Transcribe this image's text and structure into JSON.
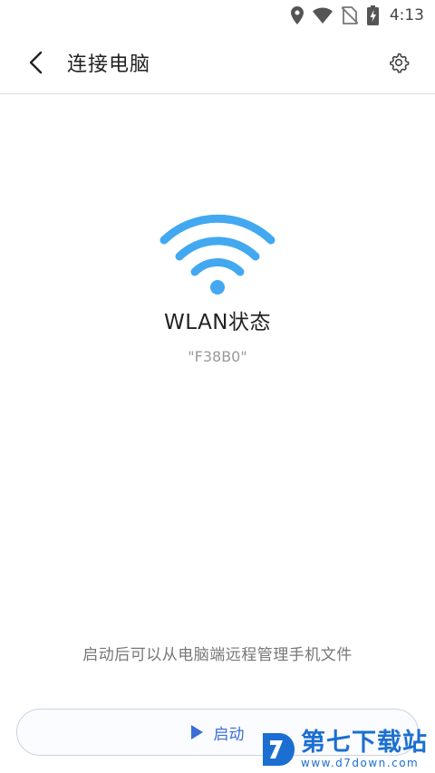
{
  "status_bar": {
    "time": "4:13",
    "icons": [
      "location-icon",
      "wifi-signal-icon",
      "no-sim-icon",
      "battery-charging-icon"
    ]
  },
  "app_bar": {
    "title": "连接电脑",
    "back_icon": "chevron-left-icon",
    "settings_icon": "gear-icon"
  },
  "wifi": {
    "icon": "wifi-icon",
    "title": "WLAN状态",
    "ssid": "\"F38B0\"",
    "color": "#42a8f0"
  },
  "hint": "启动后可以从电脑端远程管理手机文件",
  "start_button": {
    "label": "启动",
    "icon": "play-icon",
    "color": "#3a6fd8"
  },
  "watermark": {
    "logo_icon": "d7-logo-icon",
    "text": "第七下载站",
    "url": "www.d7down.com"
  }
}
